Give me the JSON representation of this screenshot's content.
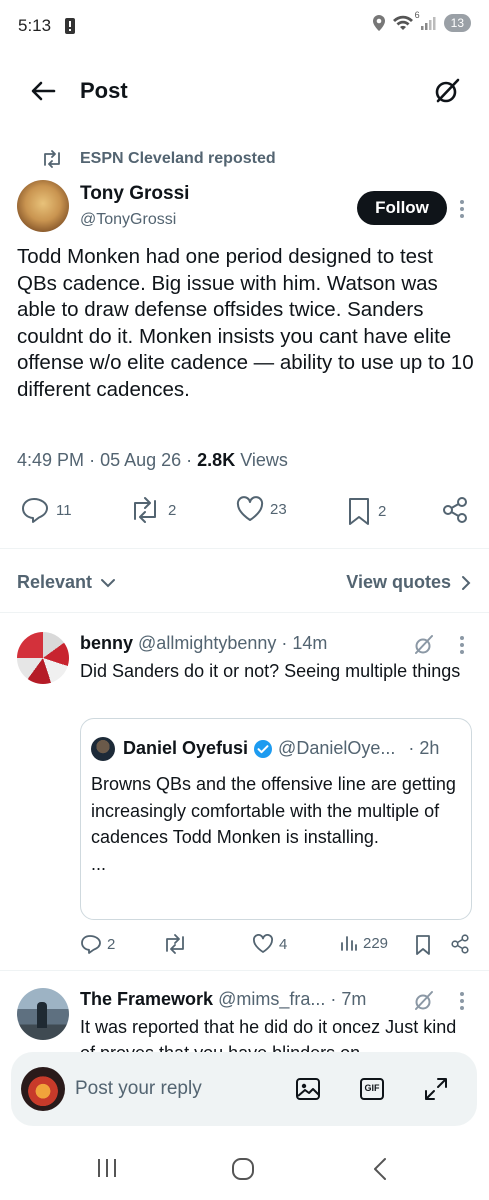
{
  "status_bar": {
    "time": "5:13",
    "signal_label": "6",
    "battery": "13"
  },
  "header": {
    "title": "Post"
  },
  "repost": {
    "text": "ESPN Cleveland reposted"
  },
  "post": {
    "author_name": "Tony Grossi",
    "author_handle": "@TonyGrossi",
    "follow_label": "Follow",
    "body": "Todd Monken had one period designed to test QBs cadence. Big issue with him. Watson was able to draw defense offsides twice. Sanders couldnt do it. Monken insists you cant have elite offense w/o elite cadence — ability to use up to 10 different cadences.",
    "time": "4:49 PM",
    "date": "05 Aug 26",
    "views_count": "2.8K",
    "views_label": "Views",
    "replies": "11",
    "reposts": "2",
    "likes": "23",
    "bookmarks": "2"
  },
  "sort": {
    "relevant_label": "Relevant",
    "view_quotes_label": "View quotes"
  },
  "replies": [
    {
      "name": "benny",
      "handle": "@allmightybenny",
      "time": "14m",
      "text": "Did Sanders do it or not? Seeing multiple things",
      "quote": {
        "name": "Daniel Oyefusi",
        "handle": "@DanielOye...",
        "time": "2h",
        "text": "Browns QBs and the offensive line are getting increasingly comfortable with the multiple of cadences Todd Monken is installing.",
        "ellipsis": "..."
      },
      "replies": "2",
      "likes": "4",
      "views": "229"
    },
    {
      "name": "The Framework",
      "handle": "@mims_fra...",
      "time": "7m",
      "text": "It was reported that he did do it oncez Just kind of proves that you have blinders on"
    }
  ],
  "composer": {
    "placeholder": "Post your reply",
    "gif_label": "GIF"
  },
  "colors": {
    "text_primary": "#0f1419",
    "text_secondary": "#536471",
    "verified_blue": "#1d9bf0",
    "divider": "#eff3f4"
  }
}
